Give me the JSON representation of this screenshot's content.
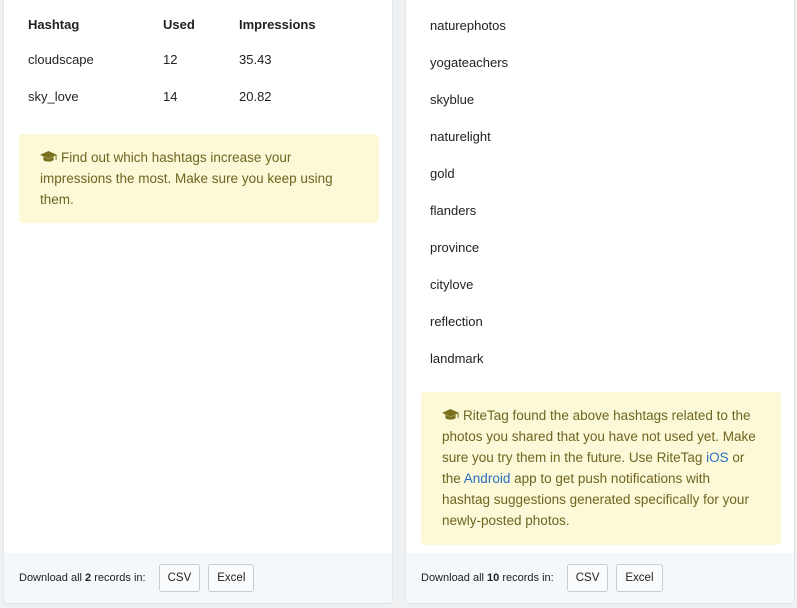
{
  "left_panel": {
    "table": {
      "headers": {
        "hashtag": "Hashtag",
        "used": "Used",
        "impressions": "Impressions"
      },
      "rows": [
        {
          "hashtag": "cloudscape",
          "used": "12",
          "impressions": "35.43"
        },
        {
          "hashtag": "sky_love",
          "used": "14",
          "impressions": "20.82"
        }
      ]
    },
    "tip": "Find out which hashtags increase your impressions the most. Make sure you keep using them.",
    "footer": {
      "prefix": "Download all",
      "count": "2",
      "suffix": "records in:",
      "csv_label": "CSV",
      "excel_label": "Excel"
    }
  },
  "right_panel": {
    "hashtags": [
      "naturephotos",
      "yogateachers",
      "skyblue",
      "naturelight",
      "gold",
      "flanders",
      "province",
      "citylove",
      "reflection",
      "landmark"
    ],
    "tip": {
      "part1": "RiteTag found the above hashtags related to the photos you shared that you have not used yet. Make sure you try them in the future. Use RiteTag",
      "ios_link": "iOS",
      "part2": "or the",
      "android_link": "Android",
      "part3": "app to get push notifications with hashtag suggestions generated specifically for your newly-posted photos."
    },
    "footer": {
      "prefix": "Download all",
      "count": "10",
      "suffix": "records in:",
      "csv_label": "CSV",
      "excel_label": "Excel"
    }
  },
  "colors": {
    "tip_background": "#fcf9d8",
    "tip_text": "#6e6520",
    "link": "#2a6fbf",
    "footer_background": "#f2f8fc"
  },
  "icons": {
    "tip_icon": "graduation-cap-icon"
  }
}
